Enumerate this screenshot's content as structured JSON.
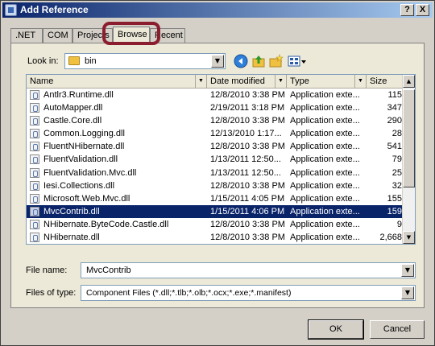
{
  "window": {
    "title": "Add Reference",
    "help_label": "?",
    "close_label": "X"
  },
  "tabs": [
    ".NET",
    "COM",
    "Projects",
    "Browse",
    "Recent"
  ],
  "active_tab": "Browse",
  "look_in": {
    "label": "Look in:",
    "value": "bin"
  },
  "toolbar_icons": [
    "back-icon",
    "up-folder-icon",
    "new-folder-icon",
    "view-menu-icon"
  ],
  "columns": {
    "name": "Name",
    "date": "Date modified",
    "type": "Type",
    "size": "Size"
  },
  "files": [
    {
      "name": "Antlr3.Runtime.dll",
      "date": "12/8/2010 3:38 PM",
      "type": "Application exte...",
      "size": "115"
    },
    {
      "name": "AutoMapper.dll",
      "date": "2/19/2011 3:18 PM",
      "type": "Application exte...",
      "size": "347"
    },
    {
      "name": "Castle.Core.dll",
      "date": "12/8/2010 3:38 PM",
      "type": "Application exte...",
      "size": "290"
    },
    {
      "name": "Common.Logging.dll",
      "date": "12/13/2010 1:17...",
      "type": "Application exte...",
      "size": "28"
    },
    {
      "name": "FluentNHibernate.dll",
      "date": "12/8/2010 3:38 PM",
      "type": "Application exte...",
      "size": "541"
    },
    {
      "name": "FluentValidation.dll",
      "date": "1/13/2011 12:50...",
      "type": "Application exte...",
      "size": "79"
    },
    {
      "name": "FluentValidation.Mvc.dll",
      "date": "1/13/2011 12:50...",
      "type": "Application exte...",
      "size": "25"
    },
    {
      "name": "Iesi.Collections.dll",
      "date": "12/8/2010 3:38 PM",
      "type": "Application exte...",
      "size": "32"
    },
    {
      "name": "Microsoft.Web.Mvc.dll",
      "date": "1/15/2011 4:05 PM",
      "type": "Application exte...",
      "size": "155"
    },
    {
      "name": "MvcContrib.dll",
      "date": "1/15/2011 4:06 PM",
      "type": "Application exte...",
      "size": "159",
      "selected": true
    },
    {
      "name": "NHibernate.ByteCode.Castle.dll",
      "date": "12/8/2010 3:38 PM",
      "type": "Application exte...",
      "size": "9"
    },
    {
      "name": "NHibernate.dll",
      "date": "12/8/2010 3:38 PM",
      "type": "Application exte...",
      "size": "2,668"
    }
  ],
  "file_name": {
    "label": "File name:",
    "value": "MvcContrib"
  },
  "files_of_type": {
    "label": "Files of type:",
    "value": "Component Files (*.dll;*.tlb;*.olb;*.ocx;*.exe;*.manifest)"
  },
  "buttons": {
    "ok": "OK",
    "cancel": "Cancel"
  },
  "colors": {
    "title_bar": "#0a246a",
    "selection": "#0a246a",
    "highlight_ring": "#8b1e2e",
    "dialog_bg": "#ece9d8"
  }
}
